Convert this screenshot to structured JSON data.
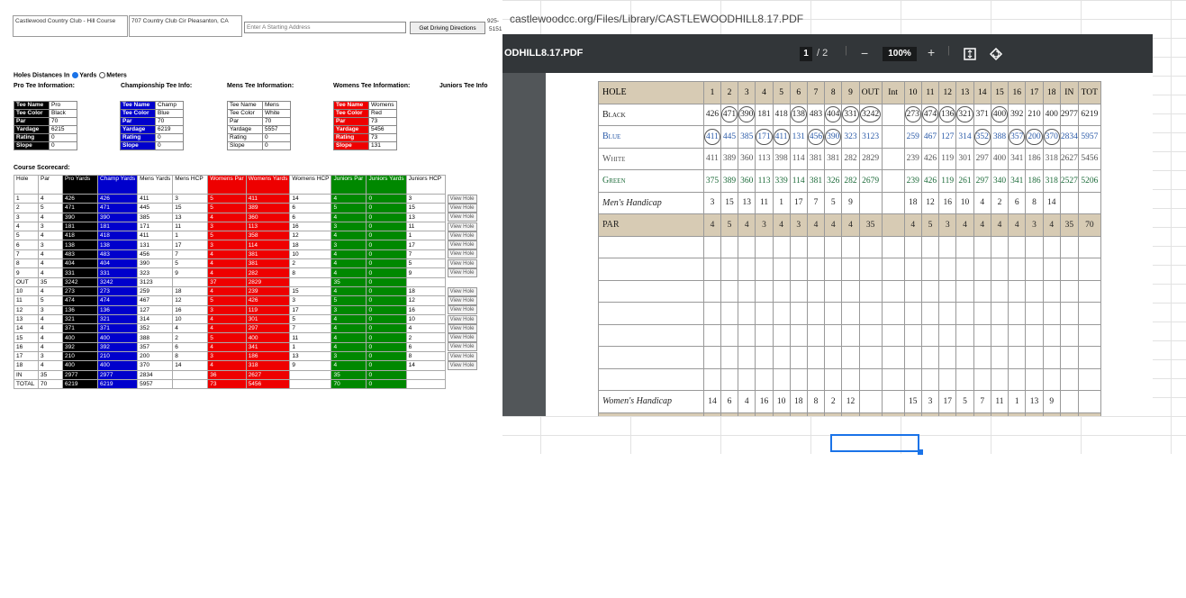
{
  "left": {
    "course_name": "Castlewood Country Club - Hill Course",
    "address": "707 Country Club Cir Pleasanton, CA",
    "start_placeholder": "Enter A Starting Address",
    "directions_btn": "Get Driving Directions",
    "phone_top": "925-",
    "phone_bot": "5151",
    "dist_label": "Holes Distances In",
    "dist_yards": "Yards",
    "dist_meters": "Meters",
    "tee_headers": [
      "Pro Tee Information:",
      "Championship Tee Info:",
      "Mens Tee Information:",
      "Womens Tee Information:",
      "Juniors Tee Info"
    ],
    "tees": [
      {
        "cls": "cpro",
        "rows": [
          [
            "Tee Name",
            "Pro"
          ],
          [
            "Tee Color",
            "Black"
          ],
          [
            "Par",
            "70"
          ],
          [
            "Yardage",
            "6215"
          ],
          [
            "Rating",
            "0"
          ],
          [
            "Slope",
            "0"
          ]
        ]
      },
      {
        "cls": "cchamp",
        "rows": [
          [
            "Tee Name",
            "Champ"
          ],
          [
            "Tee Color",
            "Blue"
          ],
          [
            "Par",
            "70"
          ],
          [
            "Yardage",
            "6219"
          ],
          [
            "Rating",
            "0"
          ],
          [
            "Slope",
            "0"
          ]
        ]
      },
      {
        "cls": "",
        "rows": [
          [
            "Tee Name",
            "Mens"
          ],
          [
            "Tee Color",
            "White"
          ],
          [
            "Par",
            "70"
          ],
          [
            "Yardage",
            "5557"
          ],
          [
            "Rating",
            "0"
          ],
          [
            "Slope",
            "0"
          ]
        ]
      },
      {
        "cls": "cwom",
        "rows": [
          [
            "Tee Name",
            "Womens"
          ],
          [
            "Tee Color",
            "Red"
          ],
          [
            "Par",
            "73"
          ],
          [
            "Yardage",
            "5456"
          ],
          [
            "Rating",
            "73"
          ],
          [
            "Slope",
            "131"
          ]
        ]
      }
    ],
    "scorecard_label": "Course Scorecard:",
    "scorecard_headers": [
      "Hole",
      "Par",
      "Pro Yards",
      "Champ Yards",
      "Mens Yards",
      "Mens HCP",
      "Womens Par",
      "Womens Yards",
      "Womens HCP",
      "Juniors Par",
      "Juniors Yards",
      "Juniors HCP"
    ],
    "view_hole": "View Hole",
    "scorecard_rows": [
      [
        "1",
        "4",
        "426",
        "426",
        "411",
        "3",
        "5",
        "411",
        "14",
        "4",
        "0",
        "3"
      ],
      [
        "2",
        "5",
        "471",
        "471",
        "445",
        "15",
        "5",
        "389",
        "6",
        "5",
        "0",
        "15"
      ],
      [
        "3",
        "4",
        "390",
        "390",
        "385",
        "13",
        "4",
        "360",
        "6",
        "4",
        "0",
        "13"
      ],
      [
        "4",
        "3",
        "181",
        "181",
        "171",
        "11",
        "3",
        "113",
        "16",
        "3",
        "0",
        "11"
      ],
      [
        "5",
        "4",
        "418",
        "418",
        "411",
        "1",
        "5",
        "358",
        "12",
        "4",
        "0",
        "1"
      ],
      [
        "6",
        "3",
        "138",
        "138",
        "131",
        "17",
        "3",
        "114",
        "18",
        "3",
        "0",
        "17"
      ],
      [
        "7",
        "4",
        "483",
        "483",
        "456",
        "7",
        "4",
        "381",
        "10",
        "4",
        "0",
        "7"
      ],
      [
        "8",
        "4",
        "404",
        "404",
        "390",
        "5",
        "4",
        "381",
        "2",
        "4",
        "0",
        "5"
      ],
      [
        "9",
        "4",
        "331",
        "331",
        "323",
        "9",
        "4",
        "282",
        "8",
        "4",
        "0",
        "9"
      ],
      [
        "OUT",
        "35",
        "3242",
        "3242",
        "3123",
        "",
        "37",
        "2829",
        "",
        "35",
        "0",
        ""
      ],
      [
        "10",
        "4",
        "273",
        "273",
        "259",
        "18",
        "4",
        "239",
        "15",
        "4",
        "0",
        "18"
      ],
      [
        "11",
        "5",
        "474",
        "474",
        "467",
        "12",
        "5",
        "426",
        "3",
        "5",
        "0",
        "12"
      ],
      [
        "12",
        "3",
        "136",
        "136",
        "127",
        "16",
        "3",
        "119",
        "17",
        "3",
        "0",
        "16"
      ],
      [
        "13",
        "4",
        "321",
        "321",
        "314",
        "10",
        "4",
        "301",
        "5",
        "4",
        "0",
        "10"
      ],
      [
        "14",
        "4",
        "371",
        "371",
        "352",
        "4",
        "4",
        "297",
        "7",
        "4",
        "0",
        "4"
      ],
      [
        "15",
        "4",
        "400",
        "400",
        "388",
        "2",
        "5",
        "400",
        "11",
        "4",
        "0",
        "2"
      ],
      [
        "16",
        "4",
        "392",
        "392",
        "357",
        "6",
        "4",
        "341",
        "1",
        "4",
        "0",
        "6"
      ],
      [
        "17",
        "3",
        "210",
        "210",
        "200",
        "8",
        "3",
        "186",
        "13",
        "3",
        "0",
        "8"
      ],
      [
        "18",
        "4",
        "400",
        "400",
        "370",
        "14",
        "4",
        "318",
        "9",
        "4",
        "0",
        "14"
      ],
      [
        "IN",
        "35",
        "2977",
        "2977",
        "2834",
        "",
        "36",
        "2627",
        "",
        "35",
        "0",
        ""
      ],
      [
        "TOTAL",
        "70",
        "6219",
        "6219",
        "5957",
        "",
        "73",
        "5456",
        "",
        "70",
        "0",
        ""
      ]
    ]
  },
  "right": {
    "url": "castlewoodcc.org/Files/Library/CASTLEWOODHILL8.17.PDF",
    "pdf_title": "ODHILL8.17.PDF",
    "page_current": "1",
    "page_total": "/ 2",
    "zoom": "100%",
    "zoom_out": "−",
    "zoom_in": "+",
    "header": [
      "HOLE",
      "1",
      "2",
      "3",
      "4",
      "5",
      "6",
      "7",
      "8",
      "9",
      "OUT",
      "Int",
      "10",
      "11",
      "12",
      "13",
      "14",
      "15",
      "16",
      "17",
      "18",
      "IN",
      "TOT"
    ],
    "rows": [
      {
        "label": "Black",
        "cls": "blk",
        "vals": [
          "426",
          "471",
          "390",
          "181",
          "418",
          "138",
          "483",
          "404",
          "331",
          "3242",
          "",
          "273",
          "474",
          "136",
          "321",
          "371",
          "400",
          "392",
          "210",
          "400",
          "2977",
          "6219"
        ],
        "circ": [
          1,
          2,
          5,
          7,
          8,
          9,
          11,
          12,
          13,
          14,
          16
        ]
      },
      {
        "label": "Blue",
        "cls": "blu",
        "vals": [
          "411",
          "445",
          "385",
          "171",
          "411",
          "131",
          "456",
          "390",
          "323",
          "3123",
          "",
          "259",
          "467",
          "127",
          "314",
          "352",
          "388",
          "357",
          "200",
          "370",
          "2834",
          "5957"
        ],
        "circ": [
          0,
          3,
          4,
          6,
          7,
          15,
          17,
          18,
          19
        ]
      },
      {
        "label": "White",
        "cls": "wht",
        "vals": [
          "411",
          "389",
          "360",
          "113",
          "398",
          "114",
          "381",
          "381",
          "282",
          "2829",
          "",
          "239",
          "426",
          "119",
          "301",
          "297",
          "400",
          "341",
          "186",
          "318",
          "2627",
          "5456"
        ],
        "circ": []
      },
      {
        "label": "Green",
        "cls": "grn",
        "vals": [
          "375",
          "389",
          "360",
          "113",
          "339",
          "114",
          "381",
          "326",
          "282",
          "2679",
          "",
          "239",
          "426",
          "119",
          "261",
          "297",
          "340",
          "341",
          "186",
          "318",
          "2527",
          "5206"
        ],
        "circ": []
      },
      {
        "label": "Men's Handicap",
        "cls": "blk",
        "italic": true,
        "vals": [
          "3",
          "15",
          "13",
          "11",
          "1",
          "17",
          "7",
          "5",
          "9",
          "",
          "",
          "18",
          "12",
          "16",
          "10",
          "4",
          "2",
          "6",
          "8",
          "14",
          "",
          ""
        ],
        "circ": []
      },
      {
        "label": "PAR",
        "cls": "blk",
        "tan": true,
        "vals": [
          "4",
          "5",
          "4",
          "3",
          "4",
          "3",
          "4",
          "4",
          "4",
          "35",
          "",
          "4",
          "5",
          "3",
          "4",
          "4",
          "4",
          "4",
          "3",
          "4",
          "35",
          "70"
        ],
        "circ": []
      },
      {
        "label": "",
        "cls": "blk",
        "vals": [
          "",
          "",
          "",
          "",
          "",
          "",
          "",
          "",
          "",
          "",
          "",
          "",
          "",
          "",
          "",
          "",
          "",
          "",
          "",
          "",
          "",
          ""
        ],
        "circ": []
      },
      {
        "label": "",
        "cls": "blk",
        "vals": [
          "",
          "",
          "",
          "",
          "",
          "",
          "",
          "",
          "",
          "",
          "",
          "",
          "",
          "",
          "",
          "",
          "",
          "",
          "",
          "",
          "",
          ""
        ],
        "circ": []
      },
      {
        "label": "",
        "cls": "blk",
        "vals": [
          "",
          "",
          "",
          "",
          "",
          "",
          "",
          "",
          "",
          "",
          "",
          "",
          "",
          "",
          "",
          "",
          "",
          "",
          "",
          "",
          "",
          ""
        ],
        "circ": []
      },
      {
        "label": "",
        "cls": "blk",
        "vals": [
          "",
          "",
          "",
          "",
          "",
          "",
          "",
          "",
          "",
          "",
          "",
          "",
          "",
          "",
          "",
          "",
          "",
          "",
          "",
          "",
          "",
          ""
        ],
        "circ": []
      },
      {
        "label": "",
        "cls": "blk",
        "vals": [
          "",
          "",
          "",
          "",
          "",
          "",
          "",
          "",
          "",
          "",
          "",
          "",
          "",
          "",
          "",
          "",
          "",
          "",
          "",
          "",
          "",
          ""
        ],
        "circ": []
      },
      {
        "label": "",
        "cls": "blk",
        "vals": [
          "",
          "",
          "",
          "",
          "",
          "",
          "",
          "",
          "",
          "",
          "",
          "",
          "",
          "",
          "",
          "",
          "",
          "",
          "",
          "",
          "",
          ""
        ],
        "circ": []
      },
      {
        "label": "",
        "cls": "blk",
        "vals": [
          "",
          "",
          "",
          "",
          "",
          "",
          "",
          "",
          "",
          "",
          "",
          "",
          "",
          "",
          "",
          "",
          "",
          "",
          "",
          "",
          "",
          ""
        ],
        "circ": []
      },
      {
        "label": "Women's Handicap",
        "cls": "blk",
        "italic": true,
        "vals": [
          "14",
          "6",
          "4",
          "16",
          "10",
          "18",
          "8",
          "2",
          "12",
          "",
          "",
          "15",
          "3",
          "17",
          "5",
          "7",
          "11",
          "1",
          "13",
          "9",
          "",
          ""
        ],
        "circ": []
      },
      {
        "label": "Women's Par",
        "cls": "blk",
        "tan": true,
        "vals": [
          "5",
          "5",
          "4",
          "3",
          "5",
          "3",
          "4",
          "4",
          "4",
          "37",
          "",
          "4",
          "5",
          "3",
          "4",
          "4",
          "5",
          "4",
          "3",
          "4",
          "36",
          "73"
        ],
        "circ": []
      }
    ]
  }
}
